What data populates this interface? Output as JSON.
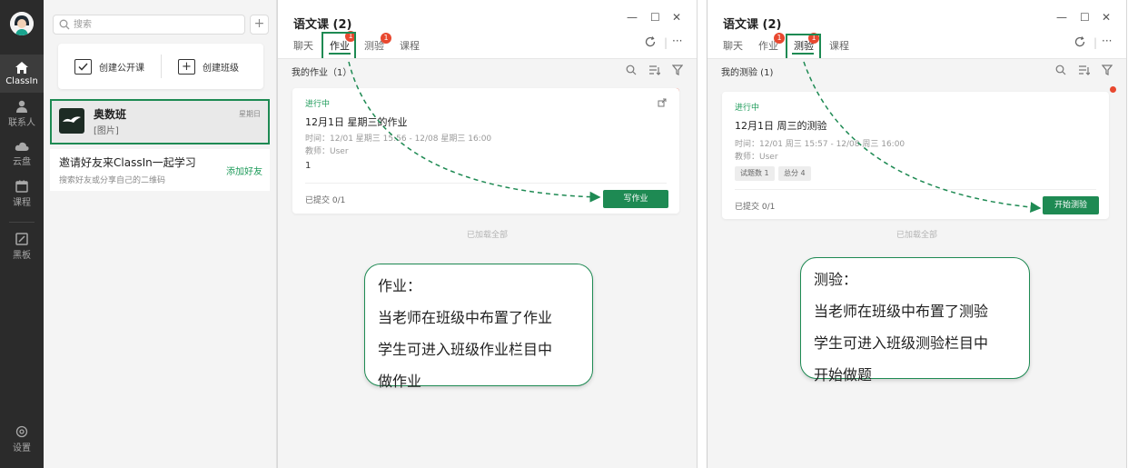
{
  "rail": {
    "app_label": "ClassIn",
    "items": [
      {
        "label": "联系人"
      },
      {
        "label": "云盘"
      },
      {
        "label": "课程"
      },
      {
        "label": "黑板"
      }
    ],
    "settings_label": "设置"
  },
  "sidebar": {
    "search_placeholder": "搜索",
    "create_public_label": "创建公开课",
    "create_class_label": "创建班级",
    "class_item": {
      "name": "奥数班",
      "preview": "[图片]",
      "day": "星期日"
    },
    "invite": {
      "title": "邀请好友来ClassIn一起学习",
      "subtitle": "搜索好友或分享自己的二维码",
      "action": "添加好友"
    }
  },
  "homework_window": {
    "title": "语文课 (2)",
    "tabs": [
      {
        "label": "聊天",
        "badge": ""
      },
      {
        "label": "作业",
        "badge": "1"
      },
      {
        "label": "测验",
        "badge": "1"
      },
      {
        "label": "课程",
        "badge": ""
      }
    ],
    "section_title": "我的作业（1）",
    "card": {
      "status": "进行中",
      "title": "12月1日 星期三的作业",
      "time": "时间：12/01 星期三 15:56 - 12/08 星期三 16:00",
      "teacher": "教师：User",
      "count": "1",
      "submitted": "已提交 0/1",
      "action": "写作业"
    },
    "loaded_all": "已加载全部",
    "callout": [
      "作业：",
      "当老师在班级中布置了作业",
      "学生可进入班级作业栏目中",
      "做作业"
    ]
  },
  "quiz_window": {
    "title": "语文课 (2)",
    "tabs": [
      {
        "label": "聊天",
        "badge": ""
      },
      {
        "label": "作业",
        "badge": "1"
      },
      {
        "label": "测验",
        "badge": "1"
      },
      {
        "label": "课程",
        "badge": ""
      }
    ],
    "section_title": "我的测验 (1)",
    "card": {
      "status": "进行中",
      "title": "12月1日 周三的测验",
      "time": "时间：12/01 周三 15:57 - 12/08 周三 16:00",
      "teacher": "教师：User",
      "tags": [
        "试题数 1",
        "总分 4"
      ],
      "submitted": "已提交 0/1",
      "action": "开始测验"
    },
    "loaded_all": "已加载全部",
    "callout": [
      "测验：",
      "当老师在班级中布置了测验",
      "学生可进入班级测验栏目中",
      "开始做题"
    ]
  },
  "colors": {
    "accent": "#1e8a53",
    "badge": "#e8482f",
    "rail": "#2b2b2b"
  }
}
